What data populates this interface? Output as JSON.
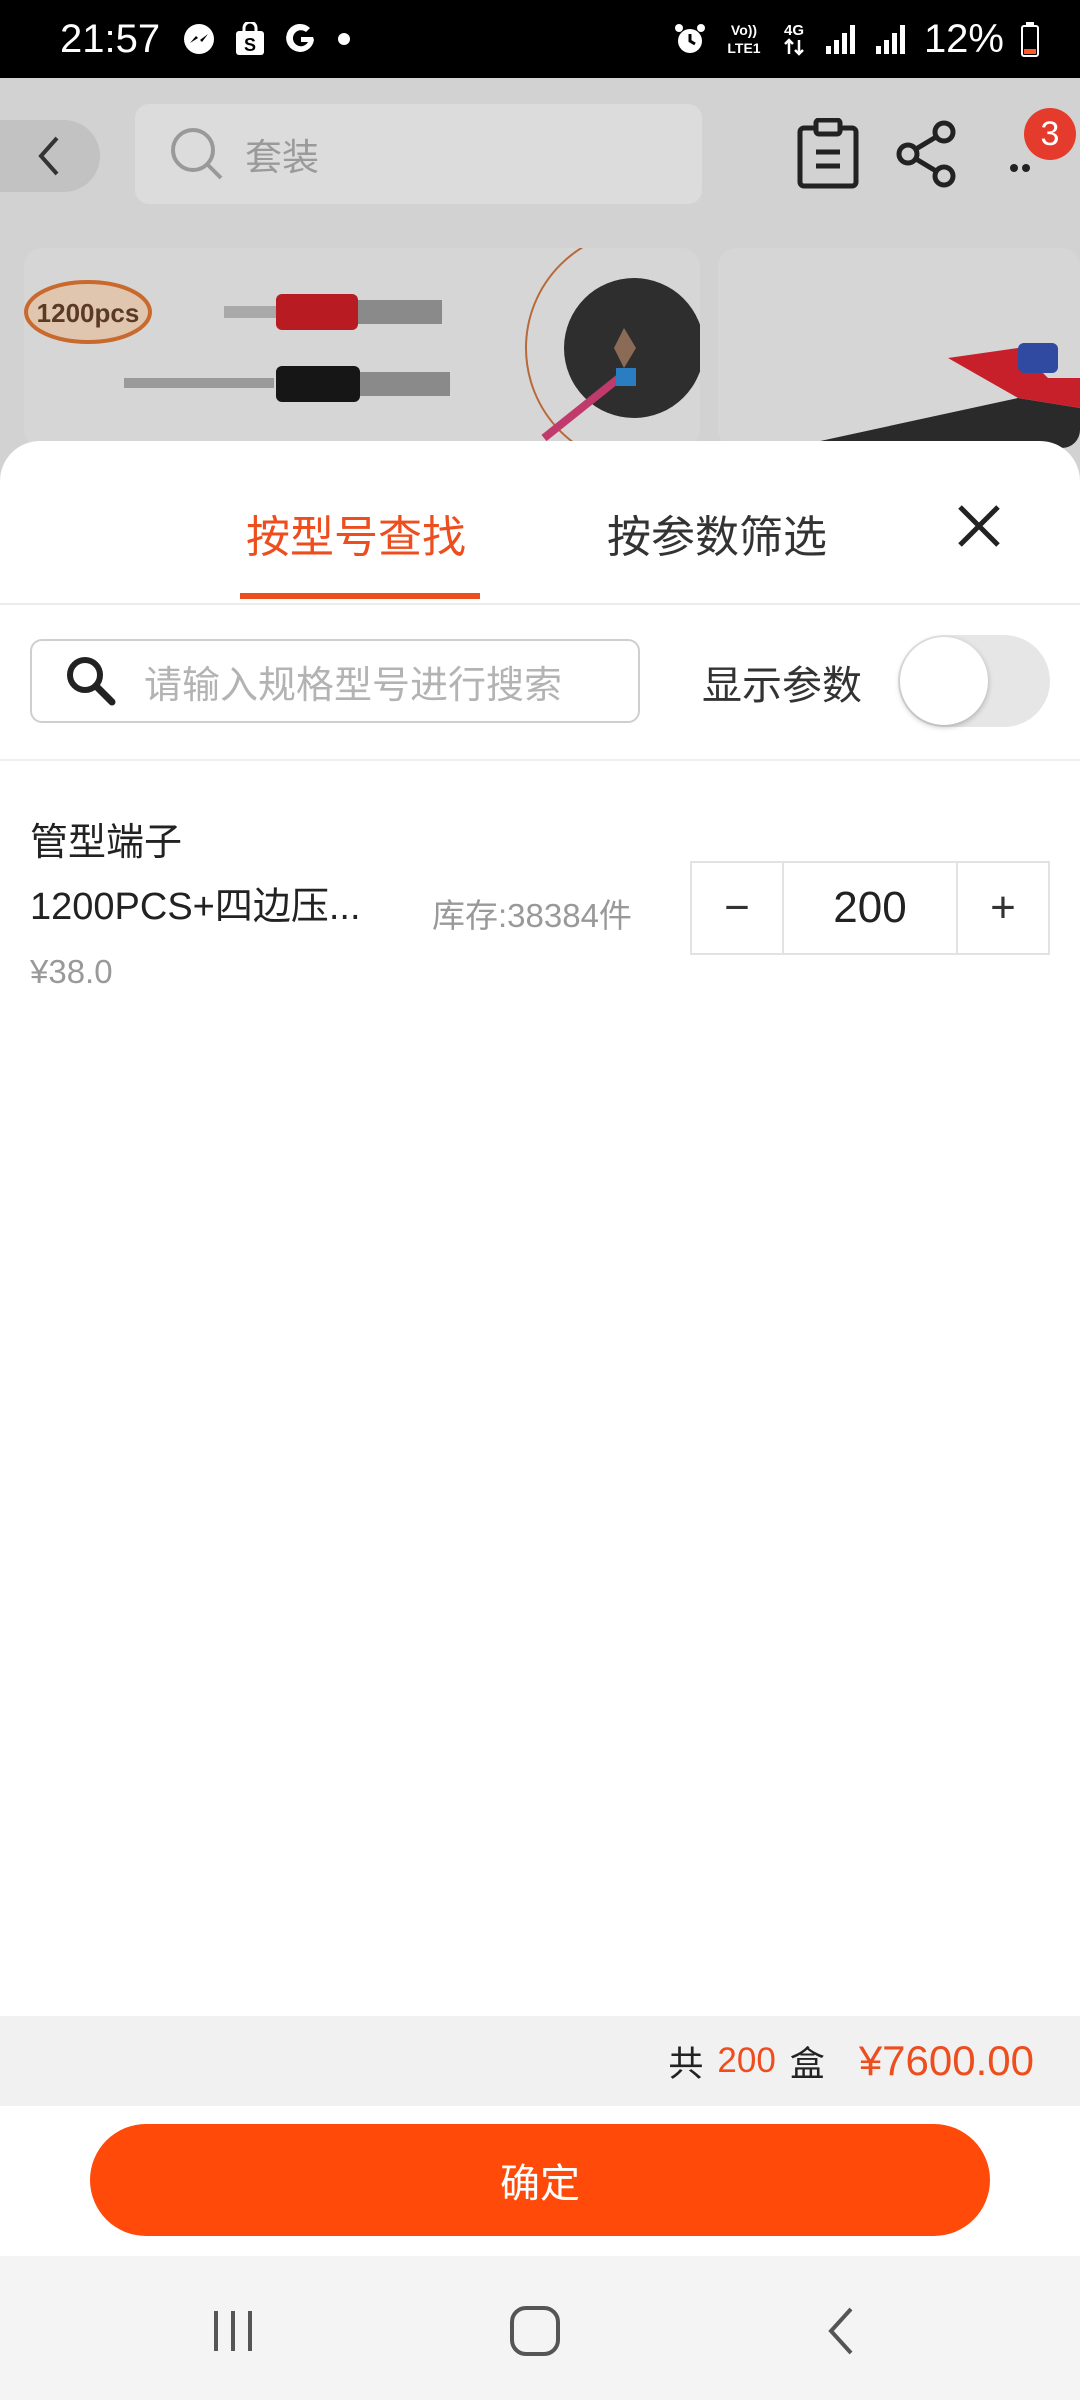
{
  "status_bar": {
    "time": "21:57",
    "notification_icons": [
      "messenger-icon",
      "shop-icon",
      "google-icon",
      "dot-icon"
    ],
    "system_icons": [
      "alarm-icon",
      "volte-icon",
      "4g-data-icon",
      "signal-icon",
      "signal-icon",
      "battery-icon"
    ],
    "volte_label": "Vo)) LTE1",
    "network_label": "4G",
    "battery_percent": "12%"
  },
  "background_page": {
    "search_placeholder": "套装",
    "cart_badge_count": "3",
    "product_image_label": "1200pcs"
  },
  "sheet": {
    "tabs": [
      {
        "label": "按型号查找",
        "active": true
      },
      {
        "label": "按参数筛选",
        "active": false
      }
    ],
    "search_placeholder": "请输入规格型号进行搜索",
    "show_params_label": "显示参数",
    "show_params_enabled": false,
    "item": {
      "name_line1": "管型端子",
      "name_line2": "1200PCS+四边压...",
      "price": "¥38.0",
      "stock": "库存:38384件",
      "quantity": "200",
      "minus_label": "−",
      "plus_label": "+"
    },
    "summary": {
      "prefix": "共",
      "quantity": "200",
      "unit": "盒",
      "total": "¥7600.00"
    },
    "confirm_label": "确定"
  },
  "colors": {
    "accent": "#ee4d1e",
    "confirm_button": "#ff4a0a",
    "badge": "#e53b2c"
  }
}
